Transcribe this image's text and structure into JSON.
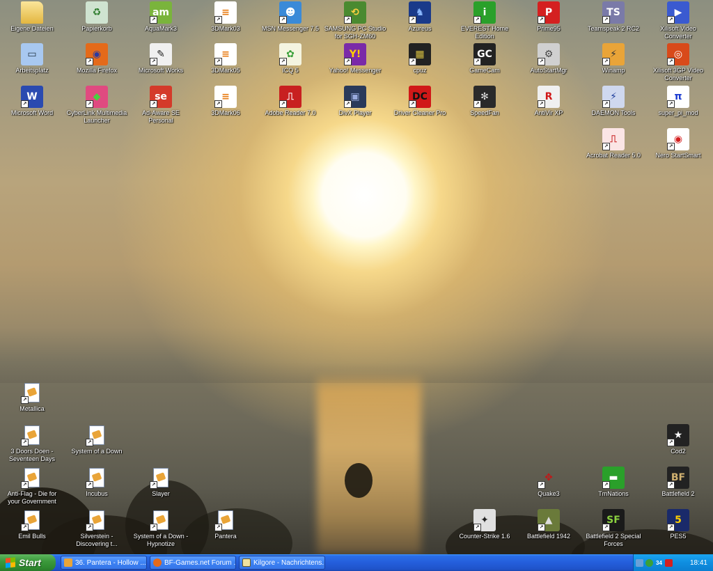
{
  "desktop": {
    "icons_top": [
      {
        "label": "Eigene Dateien",
        "icon": "my-documents-icon"
      },
      {
        "label": "Papierkorb",
        "icon": "recycle-bin-icon"
      },
      {
        "label": "AquaMark3",
        "icon": "aquamark-icon"
      },
      {
        "label": "3DMark03",
        "icon": "3dmark-icon"
      },
      {
        "label": "MSN Messenger 7.5",
        "icon": "msn-messenger-icon"
      },
      {
        "label": "SAMSUNG PC Studio for SGH-ZM60",
        "icon": "samsung-pc-studio-icon"
      },
      {
        "label": "Azureus",
        "icon": "azureus-icon"
      },
      {
        "label": "EVEREST Home Edition",
        "icon": "everest-icon"
      },
      {
        "label": "Prime95",
        "icon": "prime95-icon"
      },
      {
        "label": "Teamspeak 2 RC2",
        "icon": "teamspeak-icon"
      },
      {
        "label": "Xilisoft Video Converter",
        "icon": "xilisoft-icon"
      },
      {
        "label": "Arbeitsplatz",
        "icon": "my-computer-icon"
      },
      {
        "label": "Mozilla Firefox",
        "icon": "firefox-icon"
      },
      {
        "label": "Microsoft Works",
        "icon": "ms-works-icon"
      },
      {
        "label": "3DMark05",
        "icon": "3dmark-icon"
      },
      {
        "label": "ICQ 5",
        "icon": "icq-icon"
      },
      {
        "label": "Yahoo! Messenger",
        "icon": "yahoo-messenger-icon"
      },
      {
        "label": "cpuz",
        "icon": "cpuz-icon"
      },
      {
        "label": "GameCam",
        "icon": "gamecam-icon"
      },
      {
        "label": "AutoStartMgr",
        "icon": "autostart-icon"
      },
      {
        "label": "Winamp",
        "icon": "winamp-icon"
      },
      {
        "label": "Xilisoft 3GP Video Converter",
        "icon": "xilisoft-3gp-icon"
      },
      {
        "label": "Microsoft Word",
        "icon": "ms-word-icon"
      },
      {
        "label": "CyberLink Multimedia Launcher",
        "icon": "cyberlink-icon"
      },
      {
        "label": "Ad-Aware SE Personal",
        "icon": "adaware-icon"
      },
      {
        "label": "3DMark06",
        "icon": "3dmark-icon"
      },
      {
        "label": "Adobe Reader 7.0",
        "icon": "adobe-reader-icon"
      },
      {
        "label": "DivX Player",
        "icon": "divx-icon"
      },
      {
        "label": "Driver Cleaner Pro",
        "icon": "driver-cleaner-icon"
      },
      {
        "label": "SpeedFan",
        "icon": "speedfan-icon"
      },
      {
        "label": "AntiVir XP",
        "icon": "antivir-icon"
      },
      {
        "label": "DAEMON Tools",
        "icon": "daemon-tools-icon"
      },
      {
        "label": "super_pi_mod",
        "icon": "super-pi-icon"
      },
      {
        "label": "Acrobat Reader 5.0",
        "icon": "acrobat-icon"
      },
      {
        "label": "Nero StartSmart",
        "icon": "nero-icon"
      }
    ],
    "icons_bottom": [
      {
        "label": "Metallica",
        "icon": "playlist-icon"
      },
      {
        "label": "3 Doors Doen - Seventeen Days",
        "icon": "playlist-icon"
      },
      {
        "label": "System of a Down",
        "icon": "playlist-icon"
      },
      {
        "label": "Cod2",
        "icon": "cod2-icon"
      },
      {
        "label": "Anti-Flag - Die for your Government",
        "icon": "playlist-icon"
      },
      {
        "label": "Incubus",
        "icon": "playlist-icon"
      },
      {
        "label": "Slayer",
        "icon": "playlist-icon"
      },
      {
        "label": "Quake3",
        "icon": "quake3-icon"
      },
      {
        "label": "TmNations",
        "icon": "tmnations-icon"
      },
      {
        "label": "Battlefield 2",
        "icon": "battlefield-icon"
      },
      {
        "label": "Emil Bulls",
        "icon": "playlist-icon"
      },
      {
        "label": "Silverstein - Discovering t...",
        "icon": "playlist-icon"
      },
      {
        "label": "System of a Down - Hypnotize",
        "icon": "playlist-icon"
      },
      {
        "label": "Pantera",
        "icon": "playlist-icon"
      },
      {
        "label": "Counter-Strike 1.6",
        "icon": "counter-strike-icon"
      },
      {
        "label": "Battlefield 1942",
        "icon": "battlefield-1942-icon"
      },
      {
        "label": "Battlefield 2 Special Forces",
        "icon": "battlefield-sf-icon"
      },
      {
        "label": "PES5",
        "icon": "pes5-icon"
      }
    ]
  },
  "taskbar": {
    "start_label": "Start",
    "tasks": [
      {
        "label": "36. Pantera - Hollow ...",
        "icon": "winamp-icon"
      },
      {
        "label": "BF-Games.net Forum ...",
        "icon": "firefox-icon"
      },
      {
        "label": "Kilgore - Nachrichtens...",
        "icon": "mail-icon"
      }
    ],
    "tray": {
      "icons": [
        "network-icon",
        "speedfan-tray-icon",
        "temperature-icon",
        "antivir-tray-icon"
      ],
      "temperature": "34",
      "clock": "18:41"
    }
  },
  "colors": {
    "taskbar_blue": "#245edb",
    "start_green": "#3c9a3c",
    "tray_blue": "#0f8ee0"
  }
}
